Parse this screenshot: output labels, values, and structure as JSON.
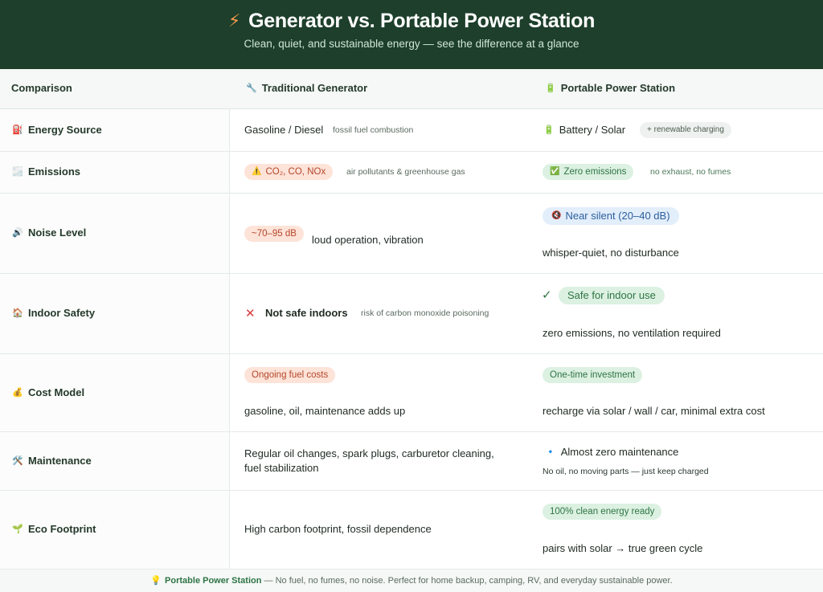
{
  "header": {
    "icon": "lightning-icon",
    "title": "Generator vs. Portable Power Station",
    "subtitle": "Clean, quiet, and sustainable energy — see the difference at a glance"
  },
  "table": {
    "columns": {
      "comparison": "Comparison",
      "generator": "Traditional Generator",
      "generator_icon": "🔧",
      "station": "Portable Power Station",
      "station_icon": "🔋"
    },
    "rows": [
      {
        "label": "Energy Source",
        "icon": "⛽",
        "gen_text": "Gasoline / Diesel",
        "gen_note": "fossil fuel combustion",
        "station_icon": "🔋",
        "station_text": "Battery / Solar",
        "station_tag": "+ renewable charging"
      },
      {
        "label": "Emissions",
        "icon": "🌫️",
        "gen_pill_icon": "⚠️",
        "gen_pill": "CO₂, CO, NOx",
        "gen_note": "air pollutants & greenhouse gas",
        "station_pill_icon": "✅",
        "station_pill": "Zero emissions",
        "station_note": "no exhaust, no fumes"
      },
      {
        "label": "Noise Level",
        "icon": "🔊",
        "gen_pill": "~70–95 dB",
        "gen_text": "loud operation, vibration",
        "station_pill_icon": "🔇",
        "station_pill": "Near silent (20–40 dB)",
        "station_text": "whisper-quiet, no disturbance"
      },
      {
        "label": "Indoor Safety",
        "icon": "🏠",
        "gen_mark": "✕",
        "gen_text": "Not safe indoors",
        "gen_note": "risk of carbon monoxide poisoning",
        "station_mark": "✓",
        "station_pill": "Safe for indoor use",
        "station_text": "zero emissions, no ventilation required"
      },
      {
        "label": "Cost Model",
        "icon": "💰",
        "gen_pill": "Ongoing fuel costs",
        "gen_text": "gasoline, oil, maintenance adds up",
        "station_pill": "One-time investment",
        "station_text": "recharge via solar / wall / car, minimal extra cost"
      },
      {
        "label": "Maintenance",
        "icon": "🛠️",
        "gen_line1": "Regular oil changes, spark plugs, carburetor cleaning,",
        "gen_line2": "fuel stabilization",
        "station_icon": "🔹",
        "station_text": "Almost zero maintenance",
        "station_note": "No oil, no moving parts — just keep charged"
      },
      {
        "label": "Eco Footprint",
        "icon": "🌱",
        "gen_text": "High carbon footprint, fossil dependence",
        "station_pill": "100% clean energy ready",
        "station_text": "pairs with solar → true green cycle"
      }
    ]
  },
  "footer": {
    "icon": "💡",
    "strong": "Portable Power Station",
    "text": " — No fuel, no fumes, no noise. Perfect for home backup, camping, RV, and everyday sustainable power."
  }
}
